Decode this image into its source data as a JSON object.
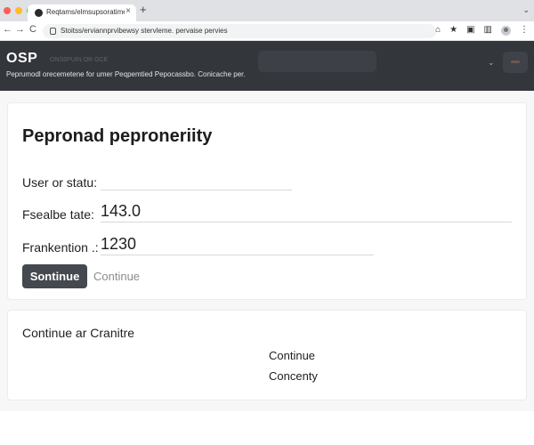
{
  "browser": {
    "tab": {
      "title": "Reqtams/elmsupsoratime",
      "close_icon": "×"
    },
    "new_tab_icon": "+",
    "tab_menu_icon": "⌄",
    "nav": {
      "back": "←",
      "forward": "→",
      "reload": "C"
    },
    "url": "Stoitss/erviannprvibewsy stervleme. pervaise pervies",
    "icons": {
      "share": "⌂",
      "star": "★",
      "tab_search": "▣",
      "sidebar": "▥",
      "menu": "⋮"
    },
    "window_dots": [
      "#ff5f57",
      "#febc2e",
      "#28c840"
    ]
  },
  "app_header": {
    "logo": "OSP",
    "subtitle": "Peprumodl orecemetene for umer Peqpemtied Pepocassbo. Conicache per.",
    "faint_text": "ONS6PUIN OR GCE",
    "chevron": "⌄",
    "bg_color": "#33363b"
  },
  "form": {
    "title": "Pepronad peproneriity",
    "fields": [
      {
        "label": "User or statu:",
        "value": ""
      },
      {
        "label": "Fsealbe tate:",
        "value": "143.0"
      },
      {
        "label": "Frankention .:",
        "value": "1230"
      }
    ],
    "primary_button": "Sontinue",
    "secondary_link": "Continue"
  },
  "second_card": {
    "heading": "Continue ar Cranitre",
    "items": [
      "Continue",
      "Concenty"
    ]
  }
}
